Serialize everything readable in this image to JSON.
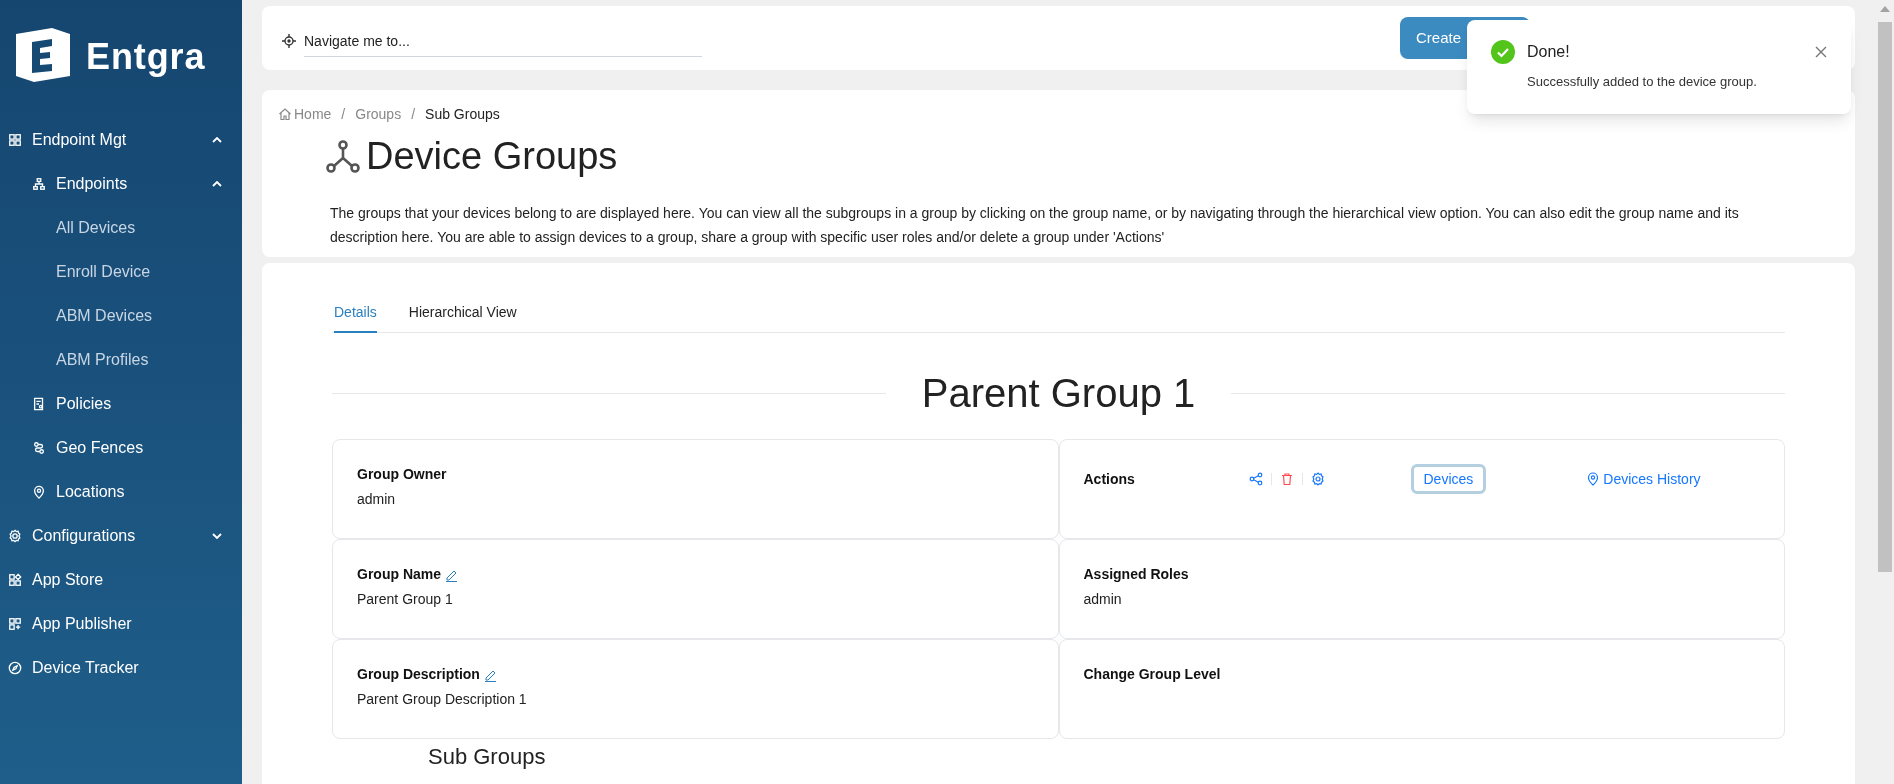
{
  "brand": {
    "name": "Entgra"
  },
  "sidebar": {
    "items": [
      {
        "label": "Endpoint Mgt",
        "expanded": true,
        "children": [
          {
            "label": "Endpoints",
            "expanded": true,
            "children": [
              {
                "label": "All Devices"
              },
              {
                "label": "Enroll Device"
              },
              {
                "label": "ABM Devices"
              },
              {
                "label": "ABM Profiles"
              }
            ]
          },
          {
            "label": "Policies"
          },
          {
            "label": "Geo Fences"
          },
          {
            "label": "Locations"
          }
        ]
      },
      {
        "label": "Configurations",
        "expanded": false
      },
      {
        "label": "App Store"
      },
      {
        "label": "App Publisher"
      },
      {
        "label": "Device Tracker"
      }
    ]
  },
  "top_bar": {
    "navigate": {
      "placeholder": "Navigate me to..."
    },
    "create_button": "Create"
  },
  "toast": {
    "kind": "success",
    "title": "Done!",
    "message": "Successfully added to the device group."
  },
  "breadcrumb": {
    "separator": "/",
    "items": [
      "Home",
      "Groups",
      "Sub Groups"
    ]
  },
  "page": {
    "title": "Device Groups",
    "description": "The groups that your devices belong to are displayed here. You can view all the subgroups in a group by clicking on the group name, or by navigating through the hierarchical view option. You can also edit the group name and its description here. You are able to assign devices to a group, share a group with specific user roles and/or delete a group under 'Actions'"
  },
  "tabs": [
    {
      "label": "Details",
      "selected": true
    },
    {
      "label": "Hierarchical View",
      "selected": false
    }
  ],
  "group_title": "Parent Group 1",
  "details": [
    {
      "kind": "field",
      "label": "Group Owner",
      "value": "admin",
      "editable": false
    },
    {
      "kind": "actions",
      "label": "Actions",
      "links": [
        {
          "label": "Devices",
          "focused": true
        },
        {
          "label": "Devices History",
          "focused": false
        }
      ]
    },
    {
      "kind": "field",
      "label": "Group Name",
      "value": "Parent Group 1",
      "editable": true
    },
    {
      "kind": "field",
      "label": "Assigned Roles",
      "value": "admin",
      "editable": false
    },
    {
      "kind": "field",
      "label": "Group Description",
      "value": "Parent Group Description 1",
      "editable": true
    },
    {
      "kind": "field",
      "label": "Change Group Level",
      "editable": false
    }
  ],
  "sub_heading": "Sub Groups"
}
